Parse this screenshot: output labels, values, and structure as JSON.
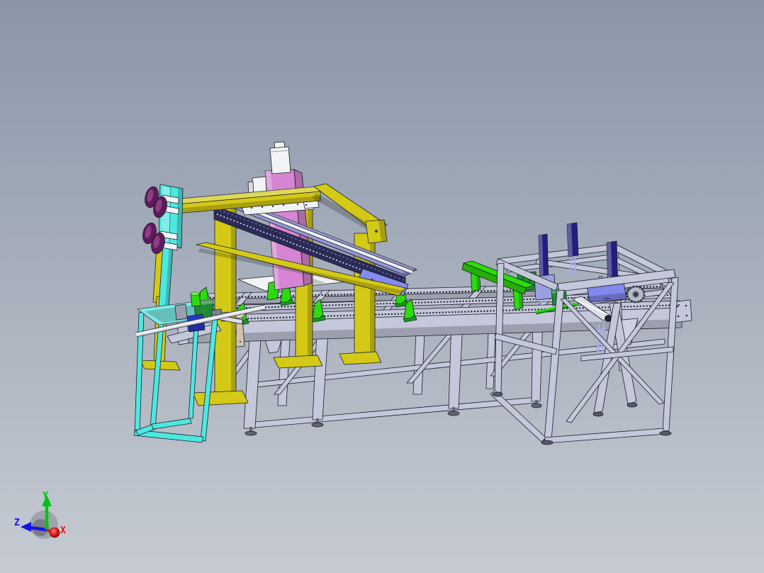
{
  "viewport": {
    "background_top": "#8a95a8",
    "background_bottom": "#c6cbd2",
    "edge_color": "#1b1e2a"
  },
  "triad": {
    "x": {
      "label": "X",
      "color": "#e81414"
    },
    "y": {
      "label": "Y",
      "color": "#00c414"
    },
    "z": {
      "label": "Z",
      "color": "#1414e8"
    },
    "sphere_color": "#84888f"
  },
  "machine": {
    "parts": {
      "frame_lavender": {
        "name": "conveyor-and-table-frame",
        "color": "#c4c8da"
      },
      "gantry_yellow": {
        "name": "gantry-frame",
        "color": "#d3c916"
      },
      "rail_navy": {
        "name": "linear-rail-body",
        "color": "#2b2b58"
      },
      "rail_top_indigo": {
        "name": "linear-rail-top",
        "color": "#6f6fc0"
      },
      "endplate_periwinkle": {
        "name": "rail-end-plate",
        "color": "#868bee"
      },
      "column_pink": {
        "name": "vertical-lift-column",
        "color": "#d685d2"
      },
      "cups_plum": {
        "name": "suction-cups",
        "color": "#5e1a5a"
      },
      "cyan_bright": {
        "name": "cyan-stand-and-plate",
        "color": "#4de8e0"
      },
      "green_bright": {
        "name": "green-fixtures",
        "color": "#2cdb0b"
      },
      "green_dark": {
        "name": "gear-motor",
        "color": "#1d8c35"
      },
      "purple_box": {
        "name": "purple-drive-box",
        "color": "#8287ec"
      },
      "tan_box": {
        "name": "tan-gearbox",
        "color": "#cdc5ac"
      },
      "white_part": {
        "name": "white-carriage-parts",
        "color": "#f2f3f5"
      },
      "silver": {
        "name": "silver-shafts",
        "color": "#dde0e7"
      },
      "blue_block": {
        "name": "blue-mount-block",
        "color": "#2838c8"
      },
      "post_navy": {
        "name": "guide-posts",
        "color": "#20207c"
      },
      "lavender_rod": {
        "name": "hanging-rods",
        "color": "#a9aee6"
      }
    }
  }
}
